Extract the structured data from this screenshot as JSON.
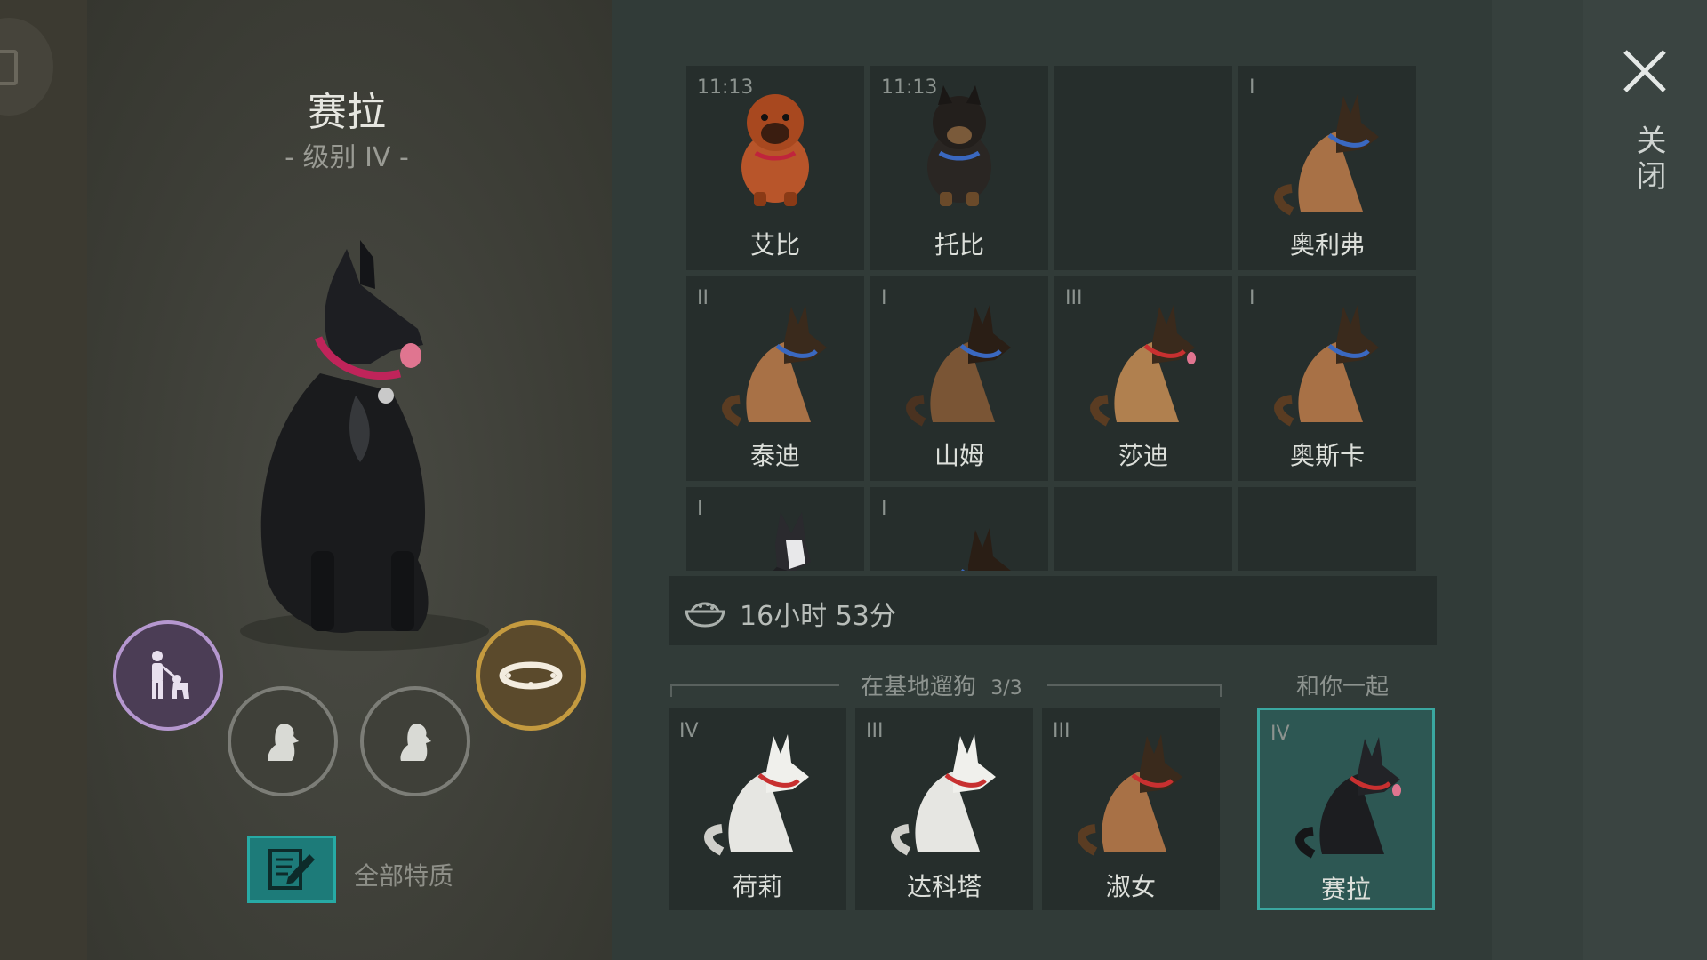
{
  "selected_dog": {
    "name": "赛拉",
    "level": "- 级别 IV -"
  },
  "actions": {
    "traits_label": "全部特质"
  },
  "kennel": [
    {
      "name": "艾比",
      "tier": "11:13",
      "coat": "puppy-red"
    },
    {
      "name": "托比",
      "tier": "11:13",
      "coat": "puppy-black"
    },
    {
      "name": "",
      "tier": "",
      "coat": "empty"
    },
    {
      "name": "奥利弗",
      "tier": "I",
      "coat": "shepherd-tan"
    },
    {
      "name": "泰迪",
      "tier": "II",
      "coat": "shepherd-tan"
    },
    {
      "name": "山姆",
      "tier": "I",
      "coat": "shepherd-dark"
    },
    {
      "name": "莎迪",
      "tier": "III",
      "coat": "shepherd-tan"
    },
    {
      "name": "奥斯卡",
      "tier": "I",
      "coat": "shepherd-tan"
    },
    {
      "name": "",
      "tier": "I",
      "coat": "husky"
    },
    {
      "name": "",
      "tier": "I",
      "coat": "shepherd-dark"
    },
    {
      "name": "",
      "tier": "",
      "coat": "empty"
    },
    {
      "name": "",
      "tier": "",
      "coat": "empty"
    }
  ],
  "timer": {
    "text": "16小时 53分"
  },
  "walk_section": {
    "title": "在基地遛狗",
    "count": "3/3",
    "dogs": [
      {
        "name": "荷莉",
        "tier": "IV",
        "coat": "white"
      },
      {
        "name": "达科塔",
        "tier": "III",
        "coat": "white"
      },
      {
        "name": "淑女",
        "tier": "III",
        "coat": "shepherd-tan"
      }
    ]
  },
  "with_you_section": {
    "title": "和你一起",
    "dog": {
      "name": "赛拉",
      "tier": "IV",
      "coat": "black"
    }
  },
  "close_label": "关闭",
  "colors": {
    "accent_teal": "#27aaa5",
    "walk_purple": "#b597cf",
    "collar_gold": "#c49a3f"
  }
}
